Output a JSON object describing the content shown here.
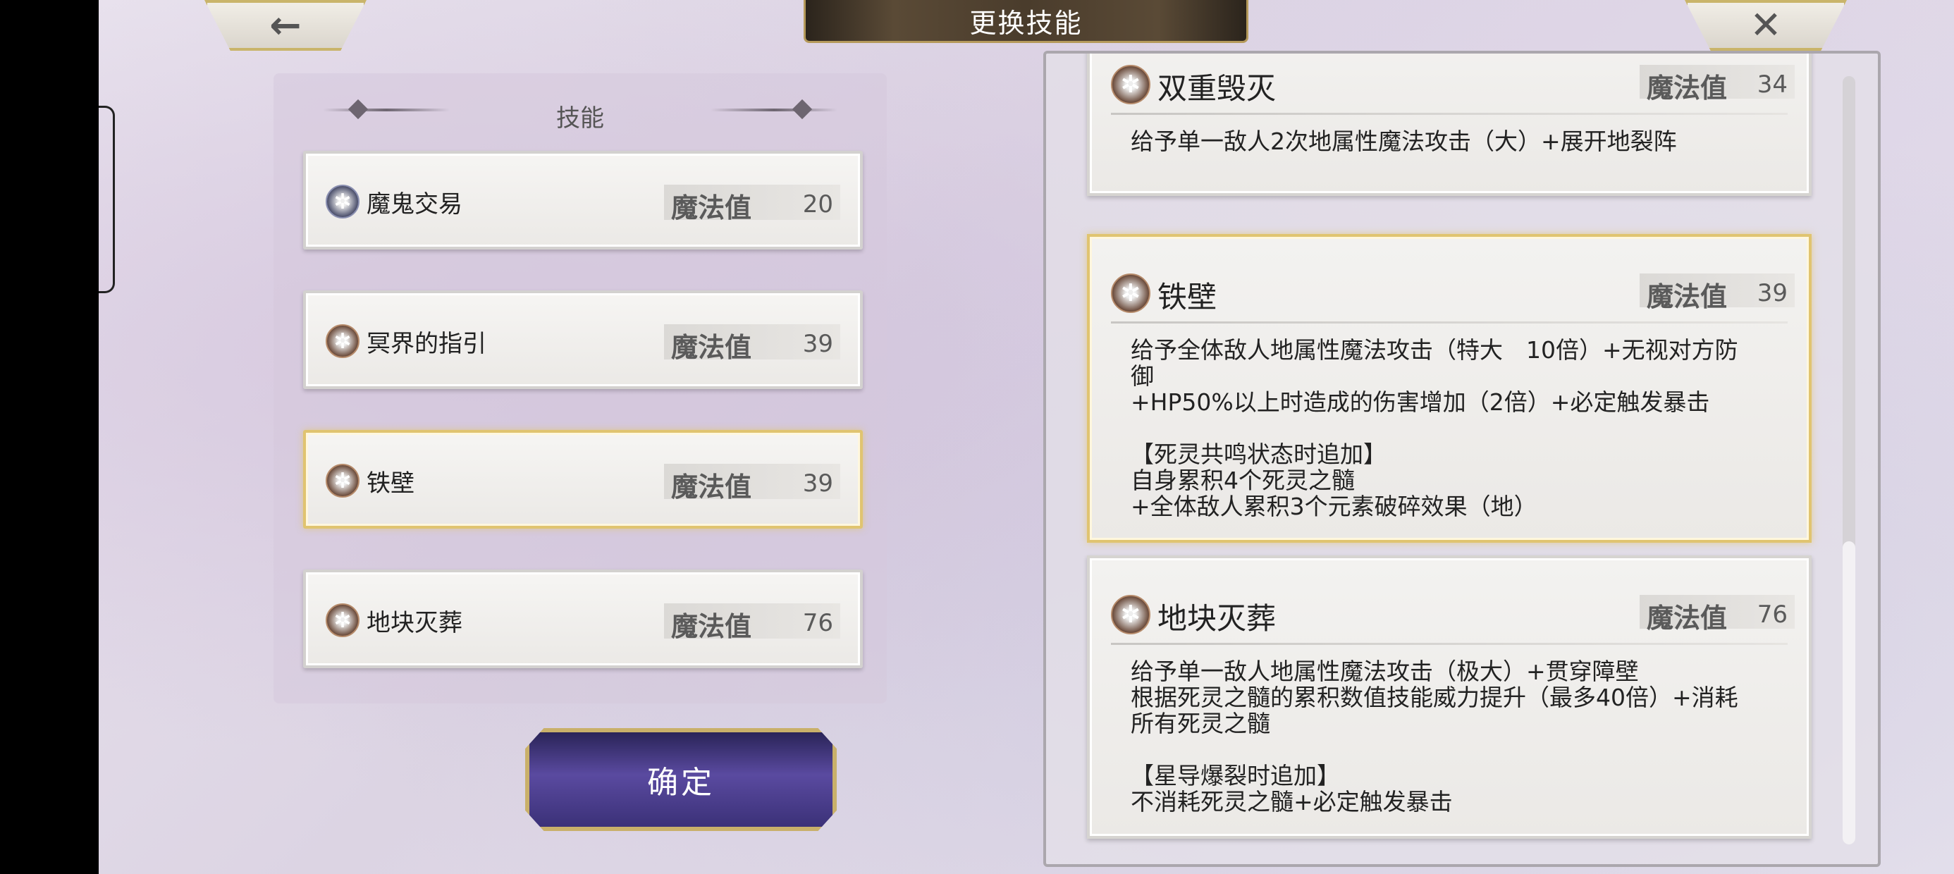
{
  "header": {
    "title": "更换技能",
    "back_icon": "←",
    "close_icon": "✕"
  },
  "left_panel": {
    "heading": "技能",
    "slots": [
      {
        "name": "魔鬼交易",
        "mana_label": "魔法值",
        "mana": "20"
      },
      {
        "name": "冥界的指引",
        "mana_label": "魔法值",
        "mana": "39"
      },
      {
        "name": "铁壁",
        "mana_label": "魔法值",
        "mana": "39"
      },
      {
        "name": "地块灭葬",
        "mana_label": "魔法值",
        "mana": "76"
      }
    ],
    "confirm_label": "确定"
  },
  "skill_list": [
    {
      "name": "双重毁灭",
      "mana_label": "魔法值",
      "mana": "34",
      "description": "给予单一敌人2次地属性魔法攻击（大）+展开地裂阵"
    },
    {
      "name": "铁壁",
      "mana_label": "魔法值",
      "mana": "39",
      "description": "给予全体敌人地属性魔法攻击（特大　10倍）+无视对方防\n御\n+HP50%以上时造成的伤害增加（2倍）+必定触发暴击\n\n【死灵共鸣状态时追加】\n自身累积4个死灵之髓\n+全体敌人累积3个元素破碎效果（地）"
    },
    {
      "name": "地块灭葬",
      "mana_label": "魔法值",
      "mana": "76",
      "description": "给予单一敌人地属性魔法攻击（极大）+贯穿障壁\n根据死灵之髓的累积数值技能威力提升（最多40倍）+消耗\n所有死灵之髓\n\n【星导爆裂时追加】\n不消耗死灵之髓+必定触发暴击"
    }
  ],
  "skill_icon": "✲"
}
